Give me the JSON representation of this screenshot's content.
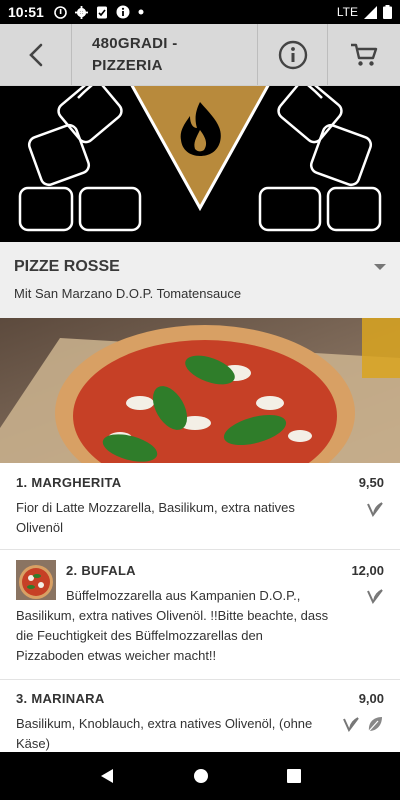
{
  "status_bar": {
    "time": "10:51",
    "network": "LTE",
    "icons": [
      "circle-info-icon",
      "gear-icon",
      "clipboard-icon",
      "info-icon",
      "dot-icon"
    ]
  },
  "app_bar": {
    "title_line1": "480GRADI -",
    "title_line2": "PIZZERIA",
    "icons": [
      "back-arrow-icon",
      "info-circle-icon",
      "cart-icon"
    ]
  },
  "category": {
    "title": "PIZZE ROSSE",
    "subtitle": "Mit San Marzano D.O.P. Tomatensauce"
  },
  "menu_items": [
    {
      "name": "1. MARGHERITA",
      "price": "9,50",
      "description": "Fior di Latte Mozzarella, Basilikum, extra natives Olivenöl",
      "icons": [
        "vegetarian-icon"
      ]
    },
    {
      "name": "2. BUFALA",
      "price": "12,00",
      "description": "Büffelmozzarella aus Kampanien D.O.P., Basilikum, extra natives Olivenöl. !!Bitte beachte, dass die Feuchtigkeit des Büffelmozzarellas den Pizzaboden etwas weicher macht!!",
      "icons": [
        "vegetarian-icon"
      ]
    },
    {
      "name": "3. MARINARA",
      "price": "9,00",
      "description": "Basilikum, Knoblauch, extra natives Olivenöl, (ohne Käse)",
      "icons": [
        "vegetarian-icon",
        "vegan-leaf-icon"
      ]
    }
  ],
  "colors": {
    "brand_gold": "#b88a3c",
    "app_bar": "#d9d9d9",
    "category_bg": "#efefef"
  }
}
